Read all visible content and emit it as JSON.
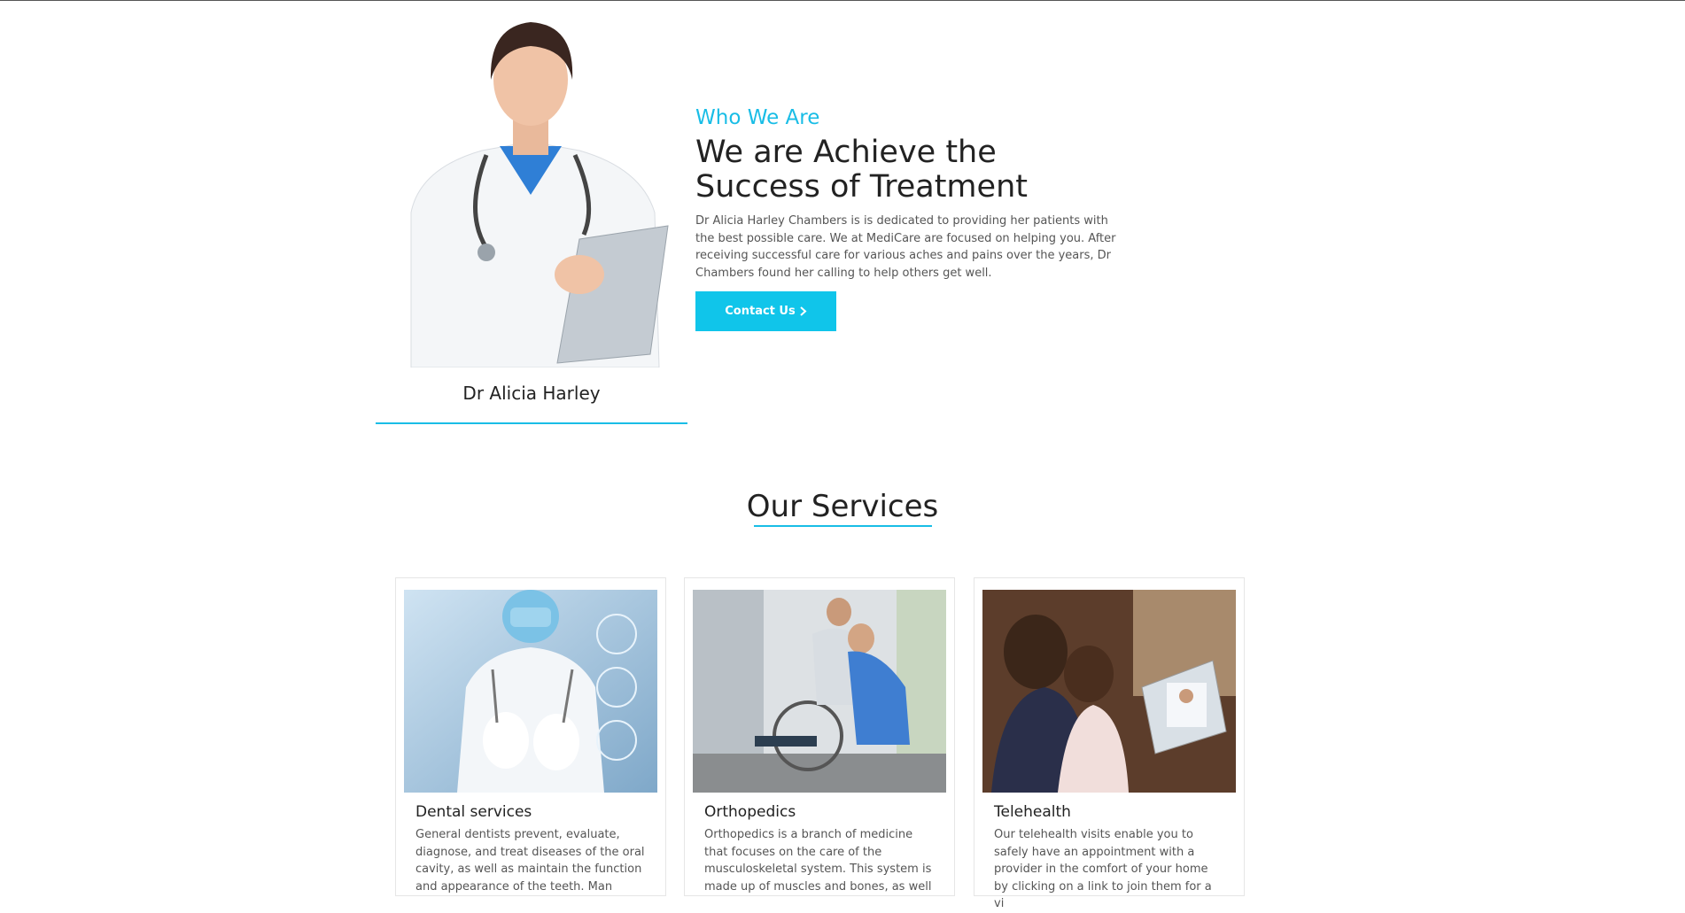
{
  "about": {
    "subtitle": "Who We Are",
    "title_line1": "We are Achieve the",
    "title_line2": "Success of Treatment",
    "description": "Dr Alicia Harley Chambers is is dedicated to providing her patients with the best possible care. We at MediCare are focused on helping you. After receiving successful care for various aches and pains over the years, Dr Chambers found her calling to help others get well.",
    "button_label": "Contact Us",
    "button_icon": "chevron-right-icon",
    "doctor_name": "Dr Alicia Harley"
  },
  "services": {
    "title": "Our Services",
    "cards": [
      {
        "title": "Dental services",
        "text": "General dentists prevent, evaluate, diagnose, and treat diseases of the oral cavity, as well as maintain the function and appearance of the teeth. Man"
      },
      {
        "title": "Orthopedics",
        "text": "Orthopedics is a branch of medicine that focuses on the care of the musculoskeletal system. This system is made up of muscles and bones, as well"
      },
      {
        "title": "Telehealth",
        "text": "Our telehealth visits enable you to safely have an appointment with a provider in the comfort of your home by clicking on a link to join them for a vi"
      }
    ]
  },
  "colors": {
    "accent": "#19bde6",
    "button": "#10c5ea",
    "heading": "#222222",
    "body_text": "#555555"
  }
}
